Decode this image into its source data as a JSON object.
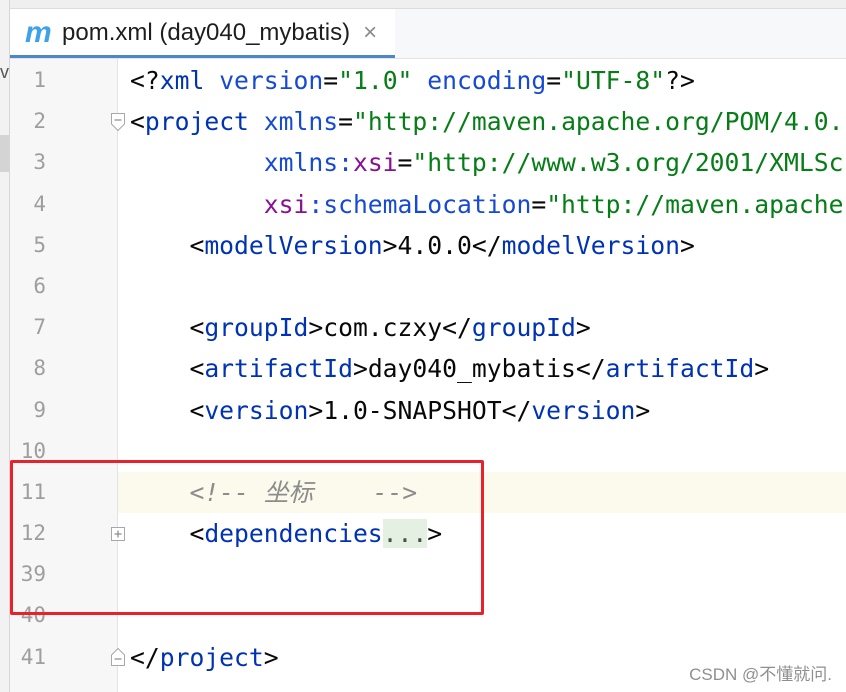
{
  "project_panel": {
    "fragment": "v"
  },
  "tabs": [
    {
      "icon": "maven-icon",
      "icon_glyph": "m",
      "label": "pom.xml (day040_mybatis)",
      "close_glyph": "×",
      "active": true
    }
  ],
  "editor": {
    "current_line": 11,
    "lines": [
      {
        "number": "1",
        "tokens": [
          "<?",
          "xml",
          " version",
          "=",
          "\"1.0\"",
          " encoding",
          "=",
          "\"UTF-8\"",
          "?>"
        ]
      },
      {
        "number": "2",
        "tokens": [
          "<",
          "project",
          " xmlns",
          "=",
          "\"http://maven.apache.org/POM/4.0."
        ]
      },
      {
        "number": "3",
        "tokens": [
          "xmlns:",
          "xsi",
          "=",
          "\"http://www.w3.org/2001/XMLSc"
        ]
      },
      {
        "number": "4",
        "tokens": [
          "xsi",
          ":schemaLocation",
          "=",
          "\"http://maven.apache"
        ]
      },
      {
        "number": "5",
        "tokens": [
          "<",
          "modelVersion",
          ">4.0.0</",
          "modelVersion",
          ">"
        ]
      },
      {
        "number": "6",
        "tokens": []
      },
      {
        "number": "7",
        "tokens": [
          "<",
          "groupId",
          ">com.czxy</",
          "groupId",
          ">"
        ]
      },
      {
        "number": "8",
        "tokens": [
          "<",
          "artifactId",
          ">day040_mybatis</",
          "artifactId",
          ">"
        ]
      },
      {
        "number": "9",
        "tokens": [
          "<",
          "version",
          ">1.0-SNAPSHOT</",
          "version",
          ">"
        ]
      },
      {
        "number": "10",
        "tokens": []
      },
      {
        "number": "11",
        "tokens": [
          "<!-- 坐标    -->"
        ]
      },
      {
        "number": "12",
        "tokens": [
          "<",
          "dependencies",
          "...",
          ">"
        ]
      },
      {
        "number": "39",
        "tokens": []
      },
      {
        "number": "40",
        "tokens": []
      },
      {
        "number": "41",
        "tokens": [
          "</",
          "project",
          ">"
        ]
      }
    ]
  },
  "watermark": "CSDN @不懂就问.",
  "colors": {
    "tag": "#0033b3",
    "attr": "#174ad4",
    "ns": "#871094",
    "string": "#067d17",
    "comment": "#8c8c8c",
    "accent": "#4a88c7",
    "annotation": "#e8212b",
    "maven_icon": "#3fa2e8",
    "current_line_bg": "#fcfaed",
    "fold_placeholder_bg": "#e4f0e2"
  }
}
